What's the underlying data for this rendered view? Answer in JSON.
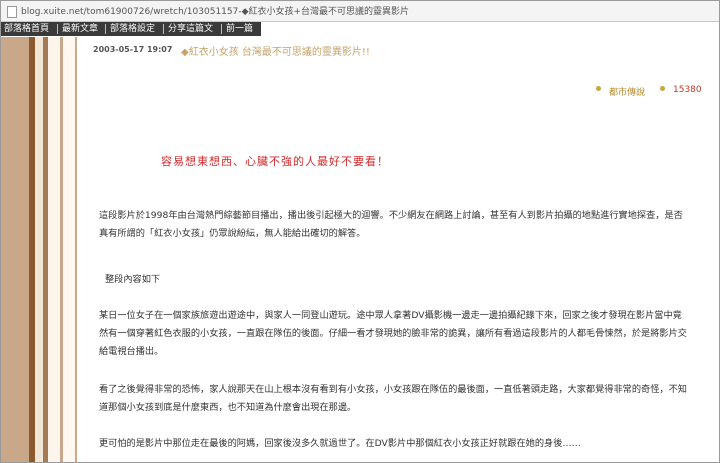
{
  "address_bar": {
    "url": "blog.xuite.net/tom61900726/wretch/103051157-◆紅衣小女孩+台灣最不可思議的靈異影片"
  },
  "nav": {
    "items": [
      {
        "label": "部落格首頁"
      },
      {
        "label": "最新文章"
      },
      {
        "label": "部落格設定"
      },
      {
        "label": "分享這篇文"
      },
      {
        "label": "前一篇"
      }
    ]
  },
  "post": {
    "date": "2003-05-17 19:07",
    "title": "◆紅衣小女孩 台灣最不可思議的靈異影片!!",
    "meta": {
      "category": "都市傳說",
      "views": "15380"
    },
    "warning": "容易想東想西、心臟不強的人最好不要看！",
    "paragraphs": [
      "這段影片於1998年由台灣熱門綜藝節目播出，播出後引起極大的迴響。不少網友在網路上討論，甚至有人到影片拍攝的地點進行實地探查，是否真有所謂的「紅衣小女孩」仍眾說紛紜，無人能給出確切的解答。",
      "整段內容如下",
      "某日一位女子在一個家族旅遊出遊途中，與家人一同登山遊玩。途中眾人拿著DV攝影機一邊走一邊拍攝紀錄下來，回家之後才發現在影片當中竟然有一個穿著紅色衣服的小女孩，一直跟在隊伍的後面。仔細一看才發現她的臉非常的詭異，讓所有看過這段影片的人都毛骨悚然，於是將影片交給電視台播出。",
      "看了之後覺得非常的恐怖，家人說那天在山上根本沒有看到有小女孩，小女孩跟在隊伍的最後面，一直低著頭走路，大家都覺得非常的奇怪，不知道那個小女孩到底是什麼東西，也不知道為什麼會出現在那邊。",
      "更可怕的是影片中那位走在最後的阿媽，回家後沒多久就過世了。在DV影片中那個紅衣小女孩正好就跟在她的身後……"
    ]
  }
}
